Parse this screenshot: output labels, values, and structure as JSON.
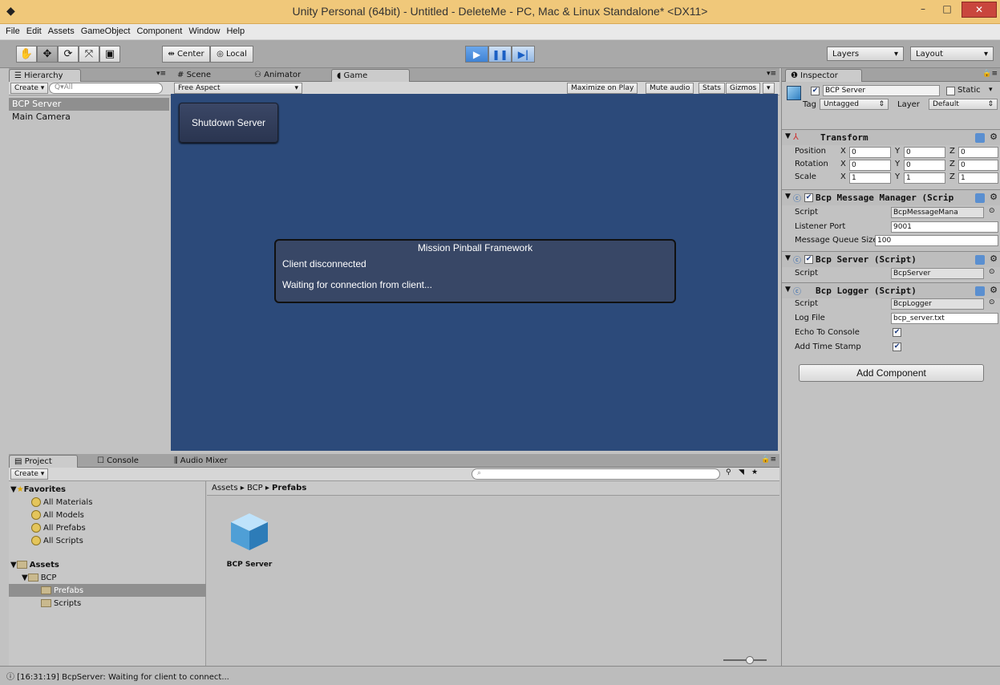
{
  "window": {
    "title": "Unity Personal (64bit) - Untitled - DeleteMe - PC, Mac & Linux Standalone* <DX11>",
    "min_glyph": "–",
    "max_glyph": "□",
    "close_glyph": "✕"
  },
  "menu": [
    "File",
    "Edit",
    "Assets",
    "GameObject",
    "Component",
    "Window",
    "Help"
  ],
  "toolbar": {
    "tools": [
      "✋",
      "✥",
      "⟳",
      "⤧",
      "▣"
    ],
    "pivot": "Center",
    "space": "Local",
    "play_glyph": "▶",
    "pause_glyph": "❚❚",
    "step_glyph": "▶|",
    "layers": "Layers",
    "layout": "Layout"
  },
  "hierarchy": {
    "tab": "Hierarchy",
    "create": "Create",
    "search_placeholder": "Q▾All",
    "items": [
      "BCP Server",
      "Main Camera"
    ]
  },
  "view_tabs": [
    "Scene",
    "Animator",
    "Game"
  ],
  "game": {
    "aspect": "Free Aspect",
    "options": [
      "Maximize on Play",
      "Mute audio",
      "Stats",
      "Gizmos"
    ],
    "shutdown_button": "Shutdown Server",
    "dialog_title": "Mission Pinball Framework",
    "dialog_line1": "Client disconnected",
    "dialog_line2": "Waiting for connection from client..."
  },
  "inspector": {
    "tab": "Inspector",
    "object_name": "BCP Server",
    "static_label": "Static",
    "tag_label": "Tag",
    "tag_value": "Untagged",
    "layer_label": "Layer",
    "layer_value": "Default",
    "transform": {
      "title": "Transform",
      "rows": [
        {
          "label": "Position",
          "x": "0",
          "y": "0",
          "z": "0"
        },
        {
          "label": "Rotation",
          "x": "0",
          "y": "0",
          "z": "0"
        },
        {
          "label": "Scale",
          "x": "1",
          "y": "1",
          "z": "1"
        }
      ],
      "axis": [
        "X",
        "Y",
        "Z"
      ]
    },
    "message_manager": {
      "title": "Bcp Message Manager (Scrip",
      "script_label": "Script",
      "script_value": "BcpMessageMana",
      "port_label": "Listener Port",
      "port_value": "9001",
      "queue_label": "Message Queue Size",
      "queue_value": "100"
    },
    "server": {
      "title": "Bcp Server (Script)",
      "script_label": "Script",
      "script_value": "BcpServer"
    },
    "logger": {
      "title": "Bcp Logger (Script)",
      "script_label": "Script",
      "script_value": "BcpLogger",
      "logfile_label": "Log File",
      "logfile_value": "bcp_server.txt",
      "echo_label": "Echo To Console",
      "timestamp_label": "Add Time Stamp"
    },
    "add_component": "Add Component"
  },
  "project": {
    "tabs": [
      "Project",
      "Console",
      "Audio Mixer"
    ],
    "create": "Create",
    "favorites": "Favorites",
    "favorite_items": [
      "All Materials",
      "All Models",
      "All Prefabs",
      "All Scripts"
    ],
    "assets": "Assets",
    "bcp": "BCP",
    "prefabs": "Prefabs",
    "scripts": "Scripts",
    "breadcrumb_assets": "Assets",
    "breadcrumb_bcp": "BCP",
    "breadcrumb_current": "Prefabs",
    "asset_name": "BCP Server"
  },
  "status": {
    "message": "[16:31:19] BcpServer: Waiting for client to connect..."
  },
  "colors": {
    "title_bar": "#f0c87a",
    "game_background": "#2c4a7a",
    "selection": "#8f8f8f"
  }
}
